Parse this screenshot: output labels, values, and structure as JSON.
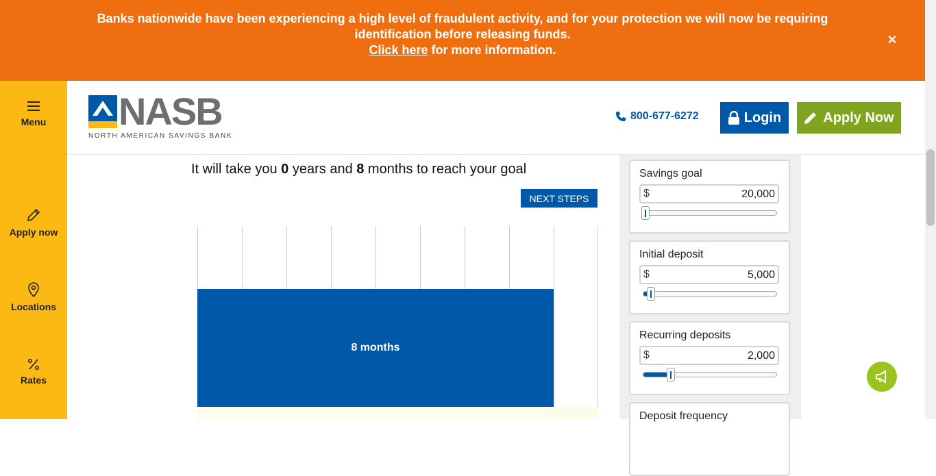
{
  "banner": {
    "line1": "Banks nationwide have been experiencing a high level of fraudulent activity, and for your protection we will now be requiring",
    "line2": "identification before releasing funds.",
    "link": "Click here",
    "line3_rest": " for more information.",
    "close": "×"
  },
  "sidebar": {
    "items": [
      {
        "label": "Menu",
        "icon": "hamburger-icon"
      },
      {
        "label": "Apply now",
        "icon": "pencil-icon"
      },
      {
        "label": "Locations",
        "icon": "map-pin-icon"
      },
      {
        "label": "Rates",
        "icon": "percent-icon"
      }
    ]
  },
  "header": {
    "logo_word": "NASB",
    "logo_tagline": "NORTH AMERICAN SAVINGS BANK",
    "phone": "800-677-6272",
    "login_label": "Login",
    "apply_label": "Apply Now"
  },
  "result": {
    "prefix": "It will take you ",
    "years": "0",
    "mid": " years and ",
    "months": "8",
    "suffix": " months to reach your goal"
  },
  "next_steps_label": "NEXT STEPS",
  "chart_data": {
    "type": "bar",
    "categories": [
      ""
    ],
    "values": [
      8
    ],
    "bar_label": "8 months",
    "xlim": [
      0,
      9
    ],
    "grid": true
  },
  "calculator": {
    "fields": [
      {
        "label": "Savings goal",
        "currency": "$",
        "value": "20,000",
        "slider_fraction": 0.0
      },
      {
        "label": "Initial deposit",
        "currency": "$",
        "value": "5,000",
        "slider_fraction": 0.04
      },
      {
        "label": "Recurring deposits",
        "currency": "$",
        "value": "2,000",
        "slider_fraction": 0.19
      },
      {
        "label": "Deposit frequency"
      }
    ]
  },
  "colors": {
    "banner": "#ef6f10",
    "brand_blue": "#0058a8",
    "brand_yellow": "#fdb913",
    "apply_green": "#7ea51d"
  }
}
